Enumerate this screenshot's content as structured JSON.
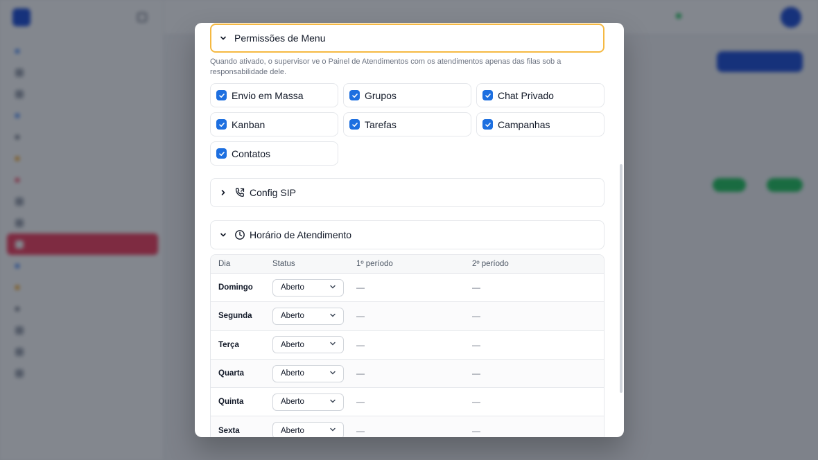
{
  "modal": {
    "menu_permissions": {
      "title": "Permissões de Menu",
      "description": "Quando ativado, o supervisor ve o Painel de Atendimentos com os atendimentos apenas das filas sob a responsabilidade dele.",
      "items": [
        {
          "label": "Envio em Massa",
          "checked": true
        },
        {
          "label": "Grupos",
          "checked": true
        },
        {
          "label": "Chat Privado",
          "checked": true
        },
        {
          "label": "Kanban",
          "checked": true
        },
        {
          "label": "Tarefas",
          "checked": true
        },
        {
          "label": "Campanhas",
          "checked": true
        },
        {
          "label": "Contatos",
          "checked": true
        }
      ]
    },
    "sip_config": {
      "title": "Config SIP",
      "icon": "phone-icon"
    },
    "business_hours": {
      "title": "Horário de Atendimento",
      "icon": "clock-icon",
      "columns": [
        "Dia",
        "Status",
        "1º período",
        "2º período"
      ],
      "rows": [
        {
          "day": "Domingo",
          "status": "Aberto",
          "p1": "—",
          "p2": "—"
        },
        {
          "day": "Segunda",
          "status": "Aberto",
          "p1": "—",
          "p2": "—"
        },
        {
          "day": "Terça",
          "status": "Aberto",
          "p1": "—",
          "p2": "—"
        },
        {
          "day": "Quarta",
          "status": "Aberto",
          "p1": "—",
          "p2": "—"
        },
        {
          "day": "Quinta",
          "status": "Aberto",
          "p1": "—",
          "p2": "—"
        },
        {
          "day": "Sexta",
          "status": "Aberto",
          "p1": "—",
          "p2": "—"
        }
      ]
    }
  },
  "colors": {
    "checkbox": "#1d6fe0",
    "focus_border": "#f5b942",
    "active_nav": "#f43f5e",
    "overlay": "rgba(17,24,39,0.52)"
  }
}
